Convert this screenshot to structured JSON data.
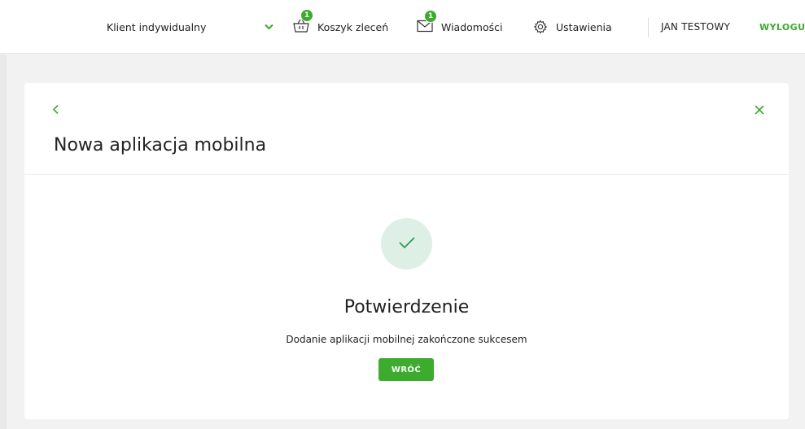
{
  "header": {
    "client_select": {
      "value": "Klient indywidualny",
      "icon": "chevron-down-icon"
    },
    "cart": {
      "label": "Koszyk zleceń",
      "badge": "1",
      "icon": "basket-icon"
    },
    "messages": {
      "label": "Wiadomości",
      "badge": "1",
      "icon": "envelope-icon"
    },
    "settings": {
      "label": "Ustawienia",
      "icon": "gear-icon"
    },
    "user_name": "JAN TESTOWY",
    "logout_label": "WYLOGUJ"
  },
  "card": {
    "title": "Nowa aplikacja mobilna",
    "back_icon": "chevron-left-icon",
    "close_icon": "close-icon"
  },
  "confirmation": {
    "icon": "checkmark-icon",
    "title": "Potwierdzenie",
    "message": "Dodanie aplikacji mobilnej zakończone sukcesem",
    "button_label": "WRÓĆ"
  },
  "colors": {
    "accent": "#3cab2e",
    "success_circle": "#deefe5",
    "background": "#f2f2f2"
  }
}
